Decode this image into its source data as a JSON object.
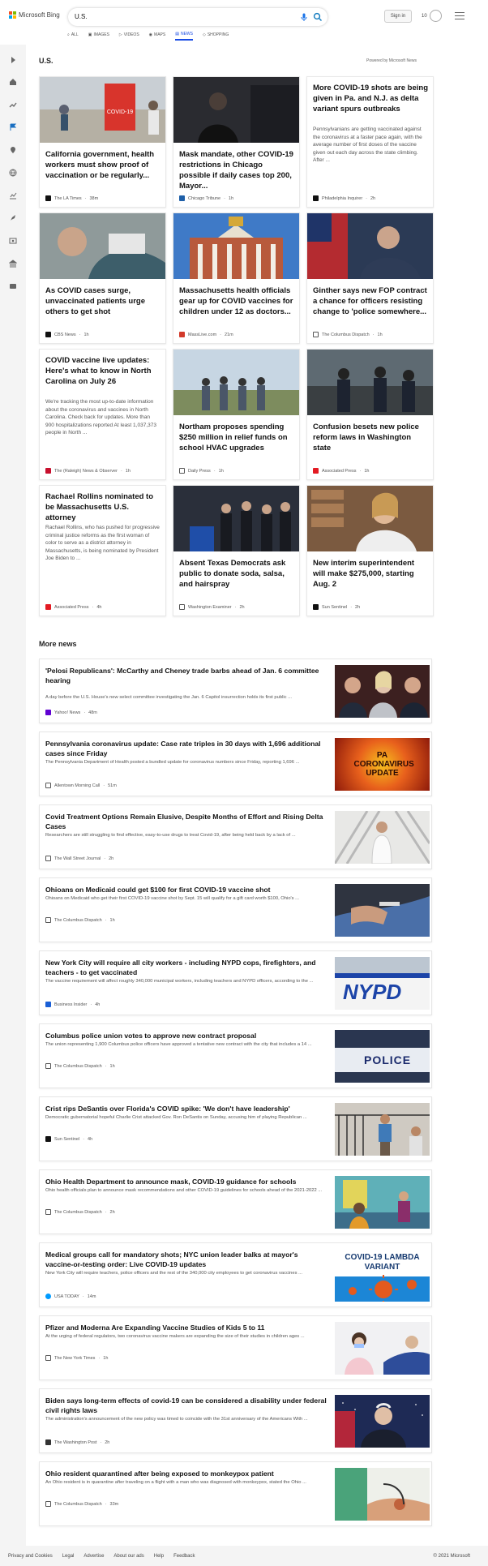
{
  "header": {
    "logo_text": "Microsoft Bing",
    "search_value": "U.S.",
    "sign_in": "Sign in",
    "points": "10"
  },
  "tabs": [
    {
      "label": "ALL"
    },
    {
      "label": "IMAGES"
    },
    {
      "label": "VIDEOS"
    },
    {
      "label": "MAPS"
    },
    {
      "label": "NEWS"
    },
    {
      "label": "SHOPPING"
    }
  ],
  "page": {
    "title": "U.S.",
    "powered_by": "Powered by Microsoft News",
    "more_news": "More news"
  },
  "cards": [
    {
      "title": "California government, health workers must show proof of vaccination or be regularly...",
      "source": "The LA Times",
      "time": "38m"
    },
    {
      "title": "Mask mandate, other COVID-19 restrictions in Chicago possible if daily cases top 200, Mayor...",
      "source": "Chicago Tribune",
      "time": "1h"
    },
    {
      "title": "More COVID-19 shots are being given in Pa. and N.J. as delta variant spurs outbreaks",
      "snippet": "Pennsylvanians are getting vaccinated against the coronavirus at a faster pace again, with the average number of first doses of the vaccine given out each day across the state climbing. After ...",
      "source": "Philadelphia Inquirer",
      "time": "2h"
    },
    {
      "title": "As COVID cases surge, unvaccinated patients urge others to get shot",
      "source": "CBS News",
      "time": "1h"
    },
    {
      "title": "Massachusetts health officials gear up for COVID vaccines for children under 12 as doctors...",
      "source": "MassLive.com",
      "time": "21m"
    },
    {
      "title": "Ginther says new FOP contract a chance for officers resisting change to 'police somewhere...",
      "source": "The Columbus Dispatch",
      "time": "1h"
    },
    {
      "title": "COVID vaccine live updates: Here's what to know in North Carolina on July 26",
      "snippet": "We're tracking the most up-to-date information about the coronavirus and vaccines in North Carolina. Check back for updates. More than 900 hospitalizations reported At least 1,037,373 people in North ...",
      "source": "The (Raleigh) News & Observer",
      "time": "1h"
    },
    {
      "title": "Northam proposes spending $250 million in relief funds on school HVAC upgrades",
      "source": "Daily Press",
      "time": "1h"
    },
    {
      "title": "Confusion besets new police reform laws in Washington state",
      "source": "Associated Press",
      "time": "1h"
    },
    {
      "title": "Rachael Rollins nominated to be Massachusetts U.S. attorney",
      "snippet": "Rachael Rollins, who has pushed for progressive criminal justice reforms as the first woman of color to serve as a district attorney in Massachusetts, is being nominated by President Joe Biden to ...",
      "source": "Associated Press",
      "time": "4h"
    },
    {
      "title": "Absent Texas Democrats ask public to donate soda, salsa, and hairspray",
      "source": "Washington Examiner",
      "time": "2h"
    },
    {
      "title": "New interim superintendent will make $275,000, starting Aug. 2",
      "source": "Sun Sentinel",
      "time": "2h"
    }
  ],
  "news": [
    {
      "title": "'Pelosi Republicans': McCarthy and Cheney trade barbs ahead of Jan. 6 committee hearing",
      "snippet": "A day before the U.S. House's new select committee investigating the Jan. 6 Capitol insurrection holds its first public ...",
      "source": "Yahoo! News",
      "time": "48m"
    },
    {
      "title": "Pennsylvania coronavirus update: Case rate triples in 30 days with 1,696 additional cases since Friday",
      "snippet": "The Pennsylvania Department of Health posted a bundled update for coronavirus numbers since Friday, reporting 1,696 ...",
      "source": "Allentown Morning Call",
      "time": "51m",
      "thumb_text": "PA CORONAVIRUS UPDATE"
    },
    {
      "title": "Covid Treatment Options Remain Elusive, Despite Months of Effort and Rising Delta Cases",
      "snippet": "Researchers are still struggling to find effective, easy-to-use drugs to treat Covid-19, after being held back by a lack of ...",
      "source": "The Wall Street Journal",
      "time": "2h"
    },
    {
      "title": "Ohioans on Medicaid could get $100 for first COVID-19 vaccine shot",
      "snippet": "Ohioans on Medicaid who get their first COVID-19 vaccine shot by Sept. 15 will qualify for a gift card worth $100, Ohio's ...",
      "source": "The Columbus Dispatch",
      "time": "1h"
    },
    {
      "title": "New York City will require all city workers - including NYPD cops, firefighters, and teachers - to get vaccinated",
      "snippet": "The vaccine requirement will affect roughly 340,000 municipal workers, including teachers and NYPD officers, according to the ...",
      "source": "Business Insider",
      "time": "4h",
      "thumb_text": "NYPD"
    },
    {
      "title": "Columbus police union votes to approve new contract proposal",
      "snippet": "The union representing 1,900 Columbus police officers have approved a tentative new contract with the city that includes a 14 ...",
      "source": "The Columbus Dispatch",
      "time": "1h",
      "thumb_text": "POLICE"
    },
    {
      "title": "Crist rips DeSantis over Florida's COVID spike: 'We don't have leadership'",
      "snippet": "Democratic gubernatorial hopeful Charlie Crist attacked Gov. Ron DeSantis on Sunday, accusing him of playing Republican ...",
      "source": "Sun Sentinel",
      "time": "4h"
    },
    {
      "title": "Ohio Health Department to announce mask, COVID-19 guidance for schools",
      "snippet": "Ohio health officials plan to announce mask recommendations and other COVID-19 guidelines for schools ahead of the 2021-2022 ...",
      "source": "The Columbus Dispatch",
      "time": "2h"
    },
    {
      "title": "Medical groups call for mandatory shots; NYC union leader balks at mayor's vaccine-or-testing order: Live COVID-19 updates",
      "snippet": "New York City will require teachers, police officers and the rest of the 340,000 city employees to get coronavirus vaccines ...",
      "source": "USA TODAY",
      "time": "14m",
      "thumb_text": "COVID-19 LAMBDA VARIANT"
    },
    {
      "title": "Pfizer and Moderna Are Expanding Vaccine Studies of Kids 5 to 11",
      "snippet": "At the urging of federal regulators, two coronavirus vaccine makers are expanding the size of their studies in children ages ...",
      "source": "The New York Times",
      "time": "1h"
    },
    {
      "title": "Biden says long-term effects of covid-19 can be considered a disability under federal civil rights laws",
      "snippet": "The administration's announcement of the new policy was timed to coincide with the 31st anniversary of the Americans With ...",
      "source": "The Washington Post",
      "time": "2h"
    },
    {
      "title": "Ohio resident quarantined after being exposed to monkeypox patient",
      "snippet": "An Ohio resident is in quarantine after traveling on a flight with a man who was diagnosed with monkeypox, stated the Ohio ...",
      "source": "The Columbus Dispatch",
      "time": "33m"
    }
  ],
  "footer": {
    "links": [
      "Privacy and Cookies",
      "Legal",
      "Advertise",
      "About our ads",
      "Help",
      "Feedback"
    ],
    "copyright": "© 2021 Microsoft"
  }
}
